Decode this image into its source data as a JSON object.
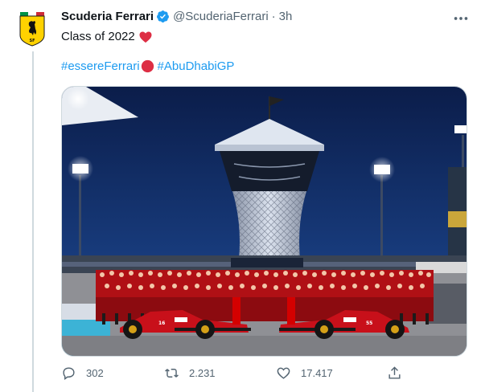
{
  "tweet": {
    "author": {
      "name": "Scuderia Ferrari",
      "handle": "@ScuderiaFerrari",
      "verified": true,
      "avatar_icon": "ferrari-shield-logo"
    },
    "separator": "·",
    "time": "3h",
    "text": "Class of 2022",
    "text_emoji": "red-heart",
    "hashtags": [
      "#essereFerrari",
      "#AbuDhabiGP"
    ],
    "hashtag_emoji": "red-circle",
    "image": {
      "description_icon": "team-photo",
      "car_numbers": [
        "16",
        "55"
      ]
    },
    "actions": {
      "reply_count": "302",
      "retweet_count": "2.231",
      "like_count": "17.417"
    }
  },
  "colors": {
    "link": "#1d9bf0",
    "muted": "#536471",
    "ferrari_red": "#d40000",
    "verified": "#1d9bf0"
  }
}
